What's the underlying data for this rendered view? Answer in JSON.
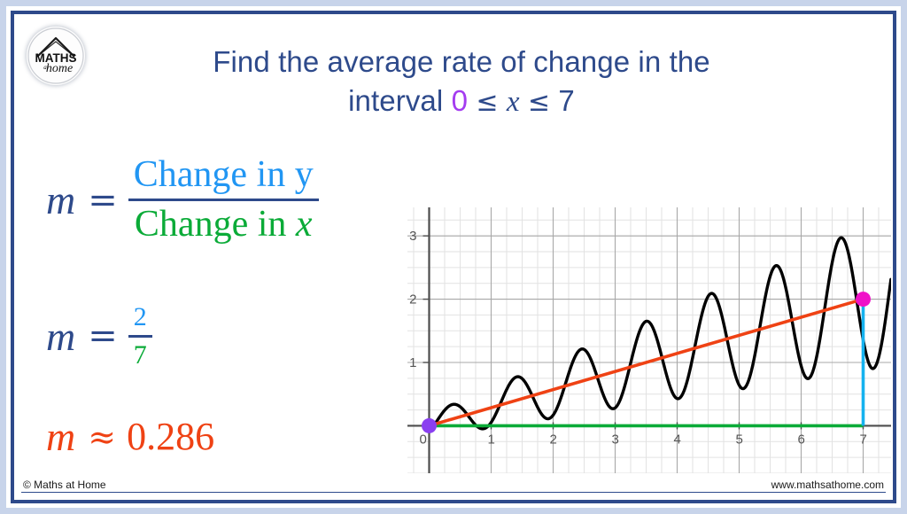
{
  "slide": {
    "title_line1": "Find the average rate of change in the",
    "title_line2_prefix": "interval",
    "title_interval_lower": "0",
    "title_le_1": "≤",
    "title_variable": "x",
    "title_le_2": "≤",
    "title_interval_upper": "7"
  },
  "logo": {
    "name": "maths-at-home-logo",
    "top_text": "MATHS",
    "mid_text": "at",
    "bottom_text": "home"
  },
  "equations": {
    "eq1": {
      "lhs": "m",
      "operator": "=",
      "numerator": "Change in y",
      "denominator_prefix": "Change in ",
      "denominator_var": "x",
      "numerator_color": "#2196f3",
      "denominator_color": "#0bab38"
    },
    "eq2": {
      "lhs": "m",
      "operator": "=",
      "numerator": "2",
      "denominator": "7"
    },
    "eq3": {
      "lhs": "m",
      "operator": "≈",
      "value": "0.286",
      "color": "#ef4214"
    }
  },
  "colors": {
    "frame_outer": "#c8d4ea",
    "frame_inner": "#2e4a8b",
    "title": "#2e4a8b",
    "accent_blue": "#2196f3",
    "accent_green": "#0bab38",
    "accent_red": "#ef4214",
    "purple_point": "#8a3ff0",
    "magenta_point": "#f012c8",
    "cyan_line": "#15b2ef",
    "curve": "#000000",
    "grid_minor": "#e2e2e2",
    "grid_major": "#a8a8a8",
    "axis": "#4d4d4d"
  },
  "chart_data": {
    "type": "line",
    "title": "",
    "xlabel": "",
    "ylabel": "",
    "xlim": [
      -0.35,
      7.45
    ],
    "ylim": [
      -0.75,
      3.45
    ],
    "grid": true,
    "legend": false,
    "x_ticks": [
      0,
      1,
      2,
      3,
      4,
      5,
      6,
      7
    ],
    "x_tick_labels": [
      "0",
      "1",
      "2",
      "3",
      "4",
      "5",
      "6",
      "7"
    ],
    "y_ticks": [
      0,
      1,
      2,
      3
    ],
    "y_tick_labels": [
      "0",
      "1",
      "2",
      "3"
    ],
    "minor_ticks_per_unit": 4,
    "series": [
      {
        "name": "function-curve",
        "color": "#000000",
        "description": "oscillating curve with growing amplitude and rising trend",
        "formula_params": {
          "trend_slope": 0.2857,
          "amplitude_base": 0.18,
          "amplitude_growth": 0.32,
          "frequency": 6.0
        }
      },
      {
        "name": "secant-line",
        "color": "#ef4214",
        "points": [
          [
            0,
            0
          ],
          [
            7,
            2
          ]
        ]
      },
      {
        "name": "change-in-x-segment",
        "color": "#0bab38",
        "points": [
          [
            0,
            0
          ],
          [
            7,
            0
          ]
        ]
      },
      {
        "name": "change-in-y-segment",
        "color": "#15b2ef",
        "points": [
          [
            7,
            0
          ],
          [
            7,
            2
          ]
        ]
      }
    ],
    "points": [
      {
        "name": "start-point",
        "x": 0,
        "y": 0,
        "color": "#8a3ff0"
      },
      {
        "name": "end-point",
        "x": 7,
        "y": 2,
        "color": "#f012c8"
      }
    ]
  },
  "footer": {
    "copyright": "© Maths at Home",
    "website": "www.mathsathome.com"
  }
}
